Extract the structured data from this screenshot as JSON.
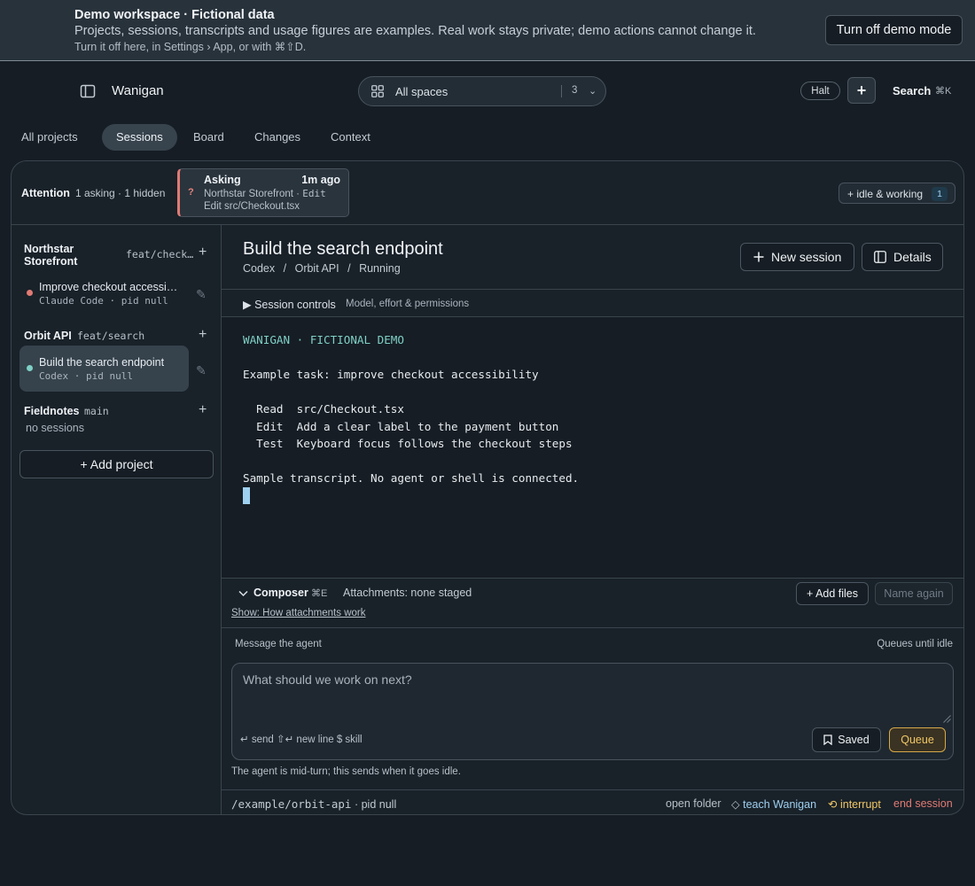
{
  "banner": {
    "title": "Demo workspace · Fictional data",
    "description": "Projects, sessions, transcripts and usage figures are examples. Real work stays private; demo actions cannot change it.",
    "hint": "Turn it off here, in Settings › App, or with ⌘⇧D.",
    "button": "Turn off demo mode"
  },
  "topbar": {
    "brand": "Wanigan",
    "spaces_label": "All spaces",
    "spaces_count": "3",
    "halt": "Halt",
    "add": "+",
    "search": "Search",
    "search_kbd": "⌘K"
  },
  "tabs": [
    "All projects",
    "Sessions",
    "Board",
    "Changes",
    "Context"
  ],
  "attention": {
    "title": "Attention",
    "meta": "1 asking · 1 hidden",
    "card": {
      "badge": "?",
      "state": "Asking",
      "time": "1m ago",
      "project": "Northstar Storefront",
      "action": "Edit",
      "detail": "Edit src/Checkout.tsx"
    },
    "idle_chip": "+ idle & working",
    "idle_count": "1"
  },
  "sidebar": {
    "projects": [
      {
        "name": "Northstar Storefront",
        "branch": "feat/check…",
        "sessions": [
          {
            "title": "Improve checkout accessi…",
            "agent": "Claude Code",
            "pid": "pid null",
            "status_color": "#e07a73"
          }
        ]
      },
      {
        "name": "Orbit API",
        "branch": "feat/search",
        "sessions": [
          {
            "title": "Build the search endpoint",
            "agent": "Codex",
            "pid": "pid null",
            "status_color": "#7fd0c6"
          }
        ]
      },
      {
        "name": "Fieldnotes",
        "branch": "main",
        "sessions": [],
        "empty": "no sessions"
      }
    ],
    "add_project": "+ Add project"
  },
  "session": {
    "title": "Build the search endpoint",
    "breadcrumbs": [
      "Codex",
      "/",
      "Orbit API",
      "/",
      "Running"
    ],
    "new_session": "New session",
    "details": "Details",
    "controls_toggle": "▶ Session controls",
    "controls_hint": "Model, effort & permissions"
  },
  "terminal": {
    "header": "WANIGAN · FICTIONAL DEMO",
    "task": "Example task: improve checkout accessibility",
    "steps": [
      "  Read  src/Checkout.tsx",
      "  Edit  Add a clear label to the payment button",
      "  Test  Keyboard focus follows the checkout steps"
    ],
    "note": "Sample transcript. No agent or shell is connected."
  },
  "composer": {
    "title": "Composer",
    "kbd": "⌘E",
    "attachments": "Attachments: none staged",
    "show_link": "Show: How attachments work",
    "add_files": "+ Add files",
    "name_again": "Name again",
    "message_label": "Message the agent",
    "queue_hint": "Queues until idle",
    "placeholder": "What should we work on next?",
    "hints": "↵ send  ⇧↵ new line  $ skill",
    "saved": "Saved",
    "queue": "Queue",
    "mid_turn_note": "The agent is mid-turn; this sends when it goes idle."
  },
  "footer": {
    "path": "/example/orbit-api",
    "sep": "·",
    "pid": "pid null",
    "open_folder": "open folder",
    "teach": "teach Wanigan",
    "interrupt": "interrupt",
    "end_session": "end session"
  },
  "colors": {
    "accent_teal": "#7fd0c6",
    "asking_red": "#e07a73",
    "queue_amber": "#f0c766",
    "link_blue": "#9ed0f0"
  }
}
